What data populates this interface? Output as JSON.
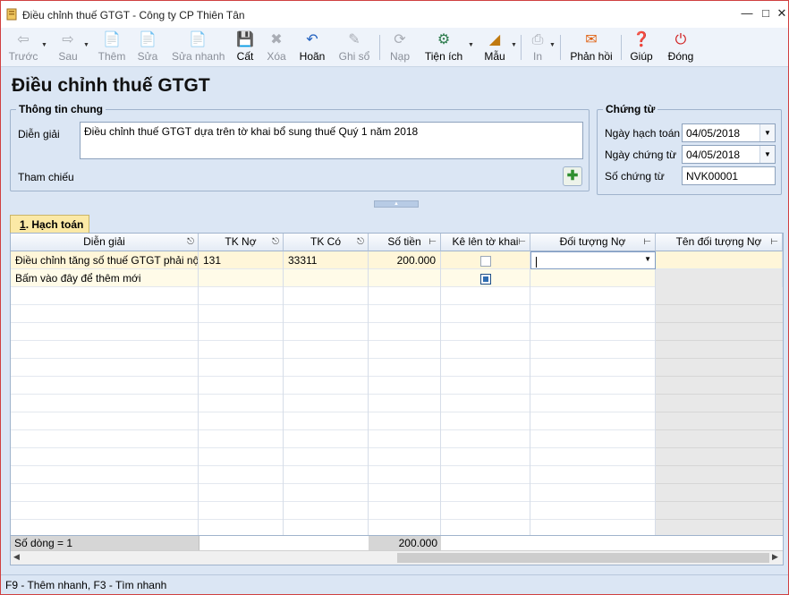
{
  "window": {
    "title": "Điều chỉnh thuế GTGT - Công ty CP Thiên Tân"
  },
  "toolbar": {
    "buttons": [
      {
        "label": "Trước",
        "icon": "arrow-left-icon",
        "enabled": false
      },
      {
        "label": "Sau",
        "icon": "arrow-right-icon",
        "enabled": false
      },
      {
        "label": "Thêm",
        "icon": "add-document-icon",
        "enabled": false
      },
      {
        "label": "Sửa",
        "icon": "edit-document-icon",
        "enabled": false
      },
      {
        "label": "Sửa nhanh",
        "icon": "quick-edit-icon",
        "enabled": false
      },
      {
        "label": "Cất",
        "icon": "save-icon",
        "enabled": true
      },
      {
        "label": "Xóa",
        "icon": "delete-icon",
        "enabled": false
      },
      {
        "label": "Hoãn",
        "icon": "undo-icon",
        "enabled": true
      },
      {
        "label": "Ghi sổ",
        "icon": "pencil-icon",
        "enabled": false
      },
      {
        "label": "Nạp",
        "icon": "reload-icon",
        "enabled": false
      },
      {
        "label": "Tiện ích",
        "icon": "tools-icon",
        "enabled": true
      },
      {
        "label": "Mẫu",
        "icon": "template-icon",
        "enabled": true
      },
      {
        "label": "In",
        "icon": "print-icon",
        "enabled": false
      },
      {
        "label": "Phản hồi",
        "icon": "mail-icon",
        "enabled": true
      },
      {
        "label": "Giúp",
        "icon": "help-icon",
        "enabled": true
      },
      {
        "label": "Đóng",
        "icon": "close-power-icon",
        "enabled": true
      }
    ]
  },
  "page_title": "Điều chỉnh thuế GTGT",
  "general_info": {
    "title": "Thông tin chung",
    "description_label": "Diễn giải",
    "description_value": "Điều chỉnh thuế GTGT dựa trên tờ khai bổ sung thuế Quý 1 năm 2018",
    "reference_label": "Tham chiếu"
  },
  "voucher": {
    "title": "Chứng từ",
    "posting_date_label": "Ngày hạch toán",
    "posting_date": "04/05/2018",
    "voucher_date_label": "Ngày chứng từ",
    "voucher_date": "04/05/2018",
    "voucher_no_label": "Số chứng từ",
    "voucher_no": "NVK00001"
  },
  "tab": {
    "underlined": "1",
    "label": ". Hạch toán"
  },
  "grid": {
    "columns": [
      "Diễn giải",
      "TK Nợ",
      "TK Có",
      "Số tiền",
      "Kê lên tờ khai",
      "Đối tượng Nợ",
      "Tên đối tượng Nợ"
    ],
    "rows": [
      {
        "description": "Điều chỉnh tăng số thuế GTGT phải nộp",
        "debit": "131",
        "credit": "33311",
        "amount": "200.000",
        "declare": false,
        "debit_object": "",
        "debit_object_name": ""
      }
    ],
    "new_row_text": "Bấm vào đây để thêm mới",
    "footer": {
      "row_count": "Số dòng = 1",
      "total_amount": "200.000"
    }
  },
  "status_bar": "F9 - Thêm nhanh, F3 - Tìm nhanh"
}
